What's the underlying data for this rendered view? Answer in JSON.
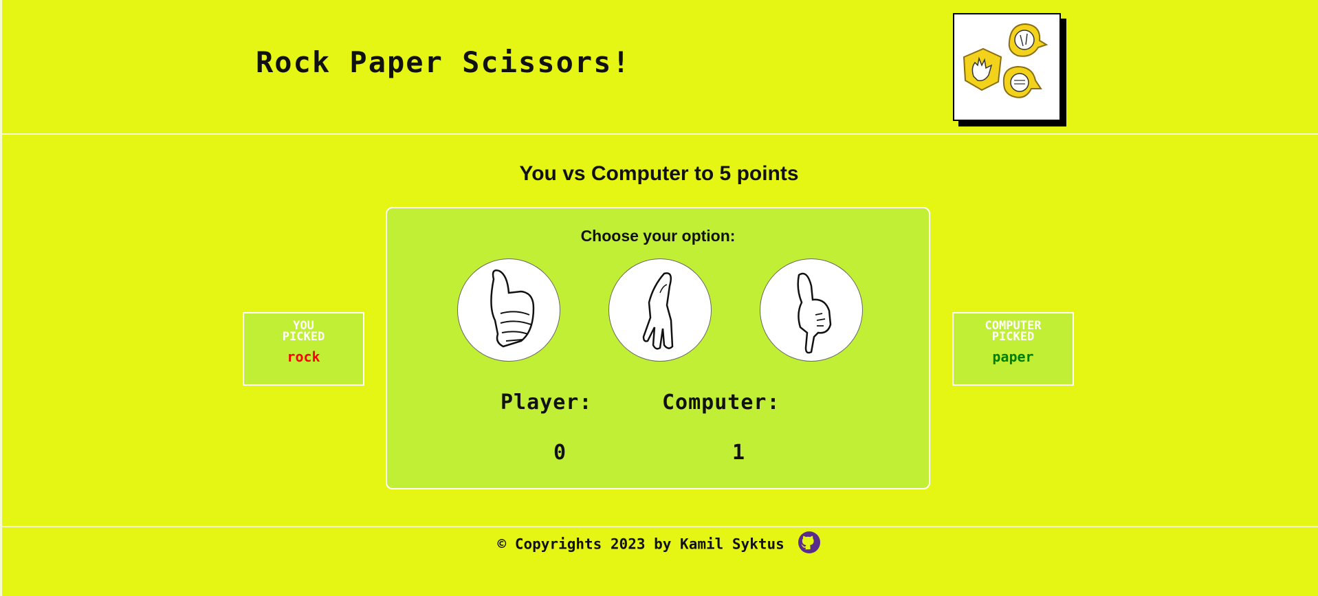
{
  "header": {
    "title": "Rock Paper Scissors!",
    "logo_icon": "rock-paper-scissors-logo"
  },
  "subtitle": "You vs Computer to 5 points",
  "game": {
    "choose_label": "Choose your option:",
    "options": [
      {
        "name": "rock",
        "icon": "fist-hand-icon"
      },
      {
        "name": "paper",
        "icon": "open-hand-icon"
      },
      {
        "name": "scissors",
        "icon": "pointing-hand-icon"
      }
    ],
    "player_label": "Player:",
    "computer_label": "Computer:",
    "player_score": "0",
    "computer_score": "1"
  },
  "player_pick": {
    "label": "YOU\nPICKED",
    "value": "rock",
    "color": "#ff0000"
  },
  "computer_pick": {
    "label": "COMPUTER\nPICKED",
    "value": "paper",
    "color": "#008000"
  },
  "footer": {
    "text": "© Copyrights 2023 by Kamil Syktus",
    "github_icon": "github-icon",
    "github_color": "#5a2d8c"
  },
  "colors": {
    "background": "#e5f514",
    "panel": "#c0ef35"
  }
}
